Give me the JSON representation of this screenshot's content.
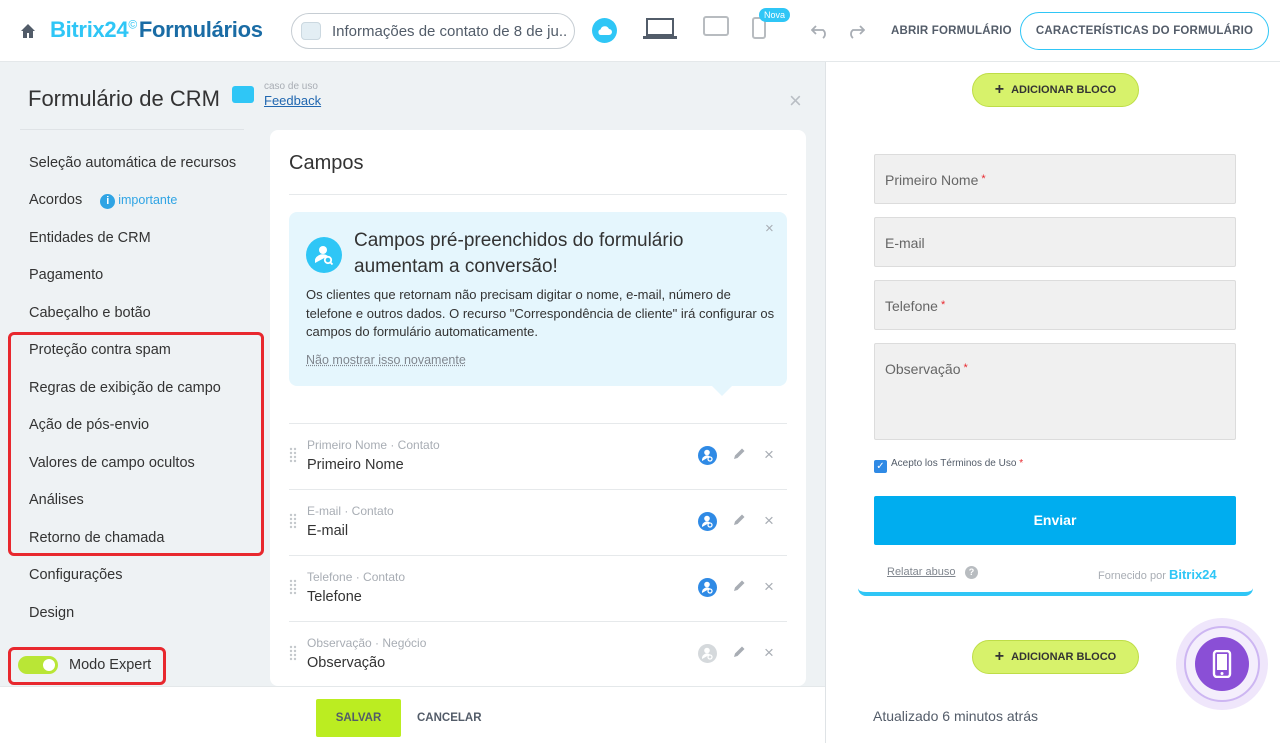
{
  "topbar": {
    "logo_brand": "Bitrix24",
    "logo_clock": "©",
    "logo_product": "Formulários",
    "form_selector": "Informações de contato de 8 de ju...",
    "badge_new": "Nova",
    "open_form": "ABRIR FORMULÁRIO",
    "form_characteristics": "CARACTERÍSTICAS DO FORMULÁRIO"
  },
  "left": {
    "title": "Formulário de CRM",
    "usecase_label": "caso de uso",
    "usecase_link": "Feedback",
    "close": "×",
    "menu": [
      "Seleção automática de recursos",
      "Acordos",
      "Entidades de CRM",
      "Pagamento",
      "Cabeçalho e botão",
      "Proteção contra spam",
      "Regras de exibição de campo",
      "Ação de pós-envio",
      "Valores de campo ocultos",
      "Análises",
      "Retorno de chamada",
      "Configurações",
      "Design"
    ],
    "importante_icon": "i",
    "importante": "importante",
    "expert_mode": "Modo Expert",
    "expert_mode_on": true
  },
  "fields_card": {
    "title": "Campos",
    "info": {
      "title": "Campos pré-preenchidos do formulário aumentam a conversão!",
      "text": "Os clientes que retornam não precisam digitar o nome, e-mail, número de telefone e outros dados. O recurso \"Correspondência de cliente\" irá configurar os campos do formulário automaticamente.",
      "hide": "Não mostrar isso novamente",
      "close": "×"
    },
    "fields": [
      {
        "sub": "Primeiro Nome · Contato",
        "name": "Primeiro Nome",
        "autofill": true
      },
      {
        "sub": "E-mail · Contato",
        "name": "E-mail",
        "autofill": true
      },
      {
        "sub": "Telefone · Contato",
        "name": "Telefone",
        "autofill": true
      },
      {
        "sub": "Observação · Negócio",
        "name": "Observação",
        "autofill": false
      }
    ],
    "delete": "×"
  },
  "footer": {
    "save": "SALVAR",
    "cancel": "CANCELAR"
  },
  "preview": {
    "add_block": "ADICIONAR BLOCO",
    "add_block_plus": "+",
    "inputs": [
      {
        "placeholder": "Primeiro Nome",
        "required": true
      },
      {
        "placeholder": "E-mail",
        "required": false
      },
      {
        "placeholder": "Telefone",
        "required": true
      },
      {
        "placeholder": "Observação",
        "required": true
      }
    ],
    "required_mark": "*",
    "terms_check": "✓",
    "terms": "Acepto los Términos de Uso",
    "send": "Enviar",
    "report_abuse": "Relatar abuso",
    "help_mark": "?",
    "powered_by": "Fornecido por",
    "powered_brand": "Bitrix24",
    "updated": "Atualizado 6 minutos atrás"
  },
  "colors": {
    "accent": "#2fc6f6",
    "brand_dark": "#1a6ca5",
    "save_green": "#bbed21",
    "highlight_red": "#e8282e",
    "send_blue": "#00adef",
    "fab_purple": "#8a4fd6"
  }
}
